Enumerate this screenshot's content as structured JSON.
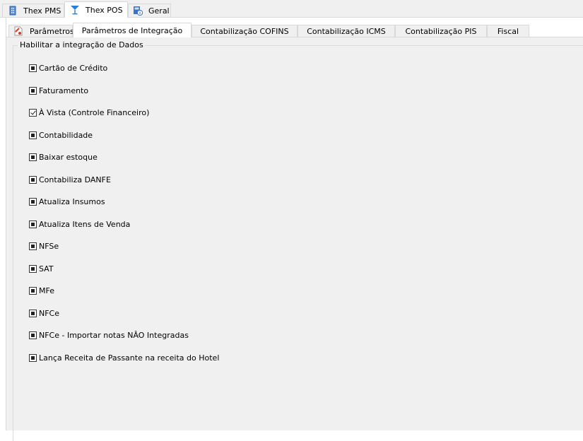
{
  "top_tabs": [
    {
      "label": "Thex PMS",
      "icon": "building-icon",
      "active": false
    },
    {
      "label": "Thex POS",
      "icon": "cocktail-glass-icon",
      "active": true
    },
    {
      "label": "Geral",
      "icon": "register-info-icon",
      "active": false
    }
  ],
  "sub_tabs": [
    {
      "label": "Parâmetros",
      "icon": "document-icon",
      "active": false
    },
    {
      "label": "Parâmetros de Integração",
      "active": true
    },
    {
      "label": "Contabilização COFINS",
      "active": false
    },
    {
      "label": "Contabilização ICMS",
      "active": false
    },
    {
      "label": "Contabilização PIS",
      "active": false
    },
    {
      "label": "Fiscal",
      "active": false
    }
  ],
  "group": {
    "title": "Habilitar a integração de Dados",
    "options": [
      {
        "label": "Cartão de Crédito",
        "state": "indeterminate"
      },
      {
        "label": "Faturamento",
        "state": "indeterminate"
      },
      {
        "label": "À Vista (Controle Financeiro)",
        "state": "checked"
      },
      {
        "label": "Contabilidade",
        "state": "indeterminate"
      },
      {
        "label": "Baixar estoque",
        "state": "indeterminate"
      },
      {
        "label": "Contabiliza DANFE",
        "state": "indeterminate"
      },
      {
        "label": "Atualiza Insumos",
        "state": "indeterminate"
      },
      {
        "label": "Atualiza Itens de Venda",
        "state": "indeterminate"
      },
      {
        "label": "NFSe",
        "state": "indeterminate"
      },
      {
        "label": "SAT",
        "state": "indeterminate"
      },
      {
        "label": "MFe",
        "state": "indeterminate"
      },
      {
        "label": "NFCe",
        "state": "indeterminate"
      },
      {
        "label": "NFCe - Importar notas NÂO Integradas",
        "state": "indeterminate"
      },
      {
        "label": "Lança Receita de Passante na receita do Hotel",
        "state": "indeterminate"
      }
    ]
  }
}
